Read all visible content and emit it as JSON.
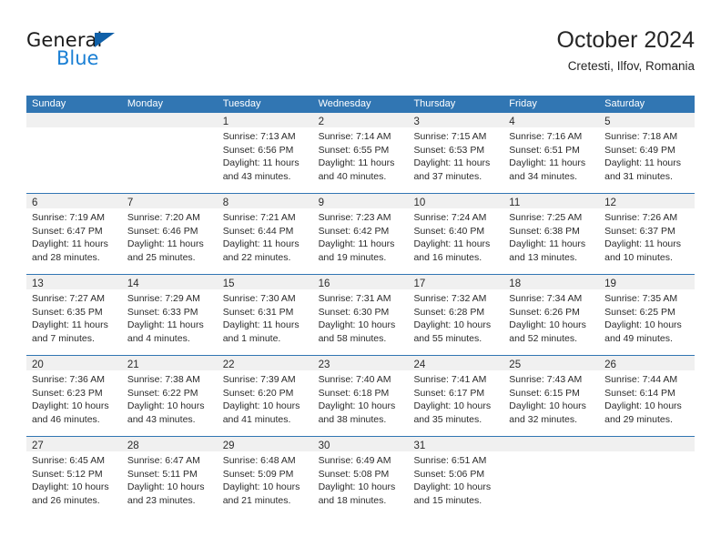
{
  "brand": {
    "name_part1": "General",
    "name_part2": "Blue",
    "triangle_icon": "triangle-icon",
    "color_dark": "#1a1a1a",
    "color_blue": "#1a7fd4"
  },
  "header": {
    "title": "October 2024",
    "subtitle": "Cretesti, Ilfov, Romania"
  },
  "theme": {
    "header_blue": "#3176b3",
    "daynum_band": "#f0f0f0",
    "text": "#2b2b2b"
  },
  "calendar": {
    "weekday_headers": [
      "Sunday",
      "Monday",
      "Tuesday",
      "Wednesday",
      "Thursday",
      "Friday",
      "Saturday"
    ],
    "labels": {
      "sunrise_prefix": "Sunrise:",
      "sunset_prefix": "Sunset:",
      "daylight_prefix": "Daylight:"
    },
    "weeks": [
      [
        {
          "day": "",
          "lines": []
        },
        {
          "day": "",
          "lines": []
        },
        {
          "day": "1",
          "lines": [
            "Sunrise: 7:13 AM",
            "Sunset: 6:56 PM",
            "Daylight: 11 hours",
            "and 43 minutes."
          ]
        },
        {
          "day": "2",
          "lines": [
            "Sunrise: 7:14 AM",
            "Sunset: 6:55 PM",
            "Daylight: 11 hours",
            "and 40 minutes."
          ]
        },
        {
          "day": "3",
          "lines": [
            "Sunrise: 7:15 AM",
            "Sunset: 6:53 PM",
            "Daylight: 11 hours",
            "and 37 minutes."
          ]
        },
        {
          "day": "4",
          "lines": [
            "Sunrise: 7:16 AM",
            "Sunset: 6:51 PM",
            "Daylight: 11 hours",
            "and 34 minutes."
          ]
        },
        {
          "day": "5",
          "lines": [
            "Sunrise: 7:18 AM",
            "Sunset: 6:49 PM",
            "Daylight: 11 hours",
            "and 31 minutes."
          ]
        }
      ],
      [
        {
          "day": "6",
          "lines": [
            "Sunrise: 7:19 AM",
            "Sunset: 6:47 PM",
            "Daylight: 11 hours",
            "and 28 minutes."
          ]
        },
        {
          "day": "7",
          "lines": [
            "Sunrise: 7:20 AM",
            "Sunset: 6:46 PM",
            "Daylight: 11 hours",
            "and 25 minutes."
          ]
        },
        {
          "day": "8",
          "lines": [
            "Sunrise: 7:21 AM",
            "Sunset: 6:44 PM",
            "Daylight: 11 hours",
            "and 22 minutes."
          ]
        },
        {
          "day": "9",
          "lines": [
            "Sunrise: 7:23 AM",
            "Sunset: 6:42 PM",
            "Daylight: 11 hours",
            "and 19 minutes."
          ]
        },
        {
          "day": "10",
          "lines": [
            "Sunrise: 7:24 AM",
            "Sunset: 6:40 PM",
            "Daylight: 11 hours",
            "and 16 minutes."
          ]
        },
        {
          "day": "11",
          "lines": [
            "Sunrise: 7:25 AM",
            "Sunset: 6:38 PM",
            "Daylight: 11 hours",
            "and 13 minutes."
          ]
        },
        {
          "day": "12",
          "lines": [
            "Sunrise: 7:26 AM",
            "Sunset: 6:37 PM",
            "Daylight: 11 hours",
            "and 10 minutes."
          ]
        }
      ],
      [
        {
          "day": "13",
          "lines": [
            "Sunrise: 7:27 AM",
            "Sunset: 6:35 PM",
            "Daylight: 11 hours",
            "and 7 minutes."
          ]
        },
        {
          "day": "14",
          "lines": [
            "Sunrise: 7:29 AM",
            "Sunset: 6:33 PM",
            "Daylight: 11 hours",
            "and 4 minutes."
          ]
        },
        {
          "day": "15",
          "lines": [
            "Sunrise: 7:30 AM",
            "Sunset: 6:31 PM",
            "Daylight: 11 hours",
            "and 1 minute."
          ]
        },
        {
          "day": "16",
          "lines": [
            "Sunrise: 7:31 AM",
            "Sunset: 6:30 PM",
            "Daylight: 10 hours",
            "and 58 minutes."
          ]
        },
        {
          "day": "17",
          "lines": [
            "Sunrise: 7:32 AM",
            "Sunset: 6:28 PM",
            "Daylight: 10 hours",
            "and 55 minutes."
          ]
        },
        {
          "day": "18",
          "lines": [
            "Sunrise: 7:34 AM",
            "Sunset: 6:26 PM",
            "Daylight: 10 hours",
            "and 52 minutes."
          ]
        },
        {
          "day": "19",
          "lines": [
            "Sunrise: 7:35 AM",
            "Sunset: 6:25 PM",
            "Daylight: 10 hours",
            "and 49 minutes."
          ]
        }
      ],
      [
        {
          "day": "20",
          "lines": [
            "Sunrise: 7:36 AM",
            "Sunset: 6:23 PM",
            "Daylight: 10 hours",
            "and 46 minutes."
          ]
        },
        {
          "day": "21",
          "lines": [
            "Sunrise: 7:38 AM",
            "Sunset: 6:22 PM",
            "Daylight: 10 hours",
            "and 43 minutes."
          ]
        },
        {
          "day": "22",
          "lines": [
            "Sunrise: 7:39 AM",
            "Sunset: 6:20 PM",
            "Daylight: 10 hours",
            "and 41 minutes."
          ]
        },
        {
          "day": "23",
          "lines": [
            "Sunrise: 7:40 AM",
            "Sunset: 6:18 PM",
            "Daylight: 10 hours",
            "and 38 minutes."
          ]
        },
        {
          "day": "24",
          "lines": [
            "Sunrise: 7:41 AM",
            "Sunset: 6:17 PM",
            "Daylight: 10 hours",
            "and 35 minutes."
          ]
        },
        {
          "day": "25",
          "lines": [
            "Sunrise: 7:43 AM",
            "Sunset: 6:15 PM",
            "Daylight: 10 hours",
            "and 32 minutes."
          ]
        },
        {
          "day": "26",
          "lines": [
            "Sunrise: 7:44 AM",
            "Sunset: 6:14 PM",
            "Daylight: 10 hours",
            "and 29 minutes."
          ]
        }
      ],
      [
        {
          "day": "27",
          "lines": [
            "Sunrise: 6:45 AM",
            "Sunset: 5:12 PM",
            "Daylight: 10 hours",
            "and 26 minutes."
          ]
        },
        {
          "day": "28",
          "lines": [
            "Sunrise: 6:47 AM",
            "Sunset: 5:11 PM",
            "Daylight: 10 hours",
            "and 23 minutes."
          ]
        },
        {
          "day": "29",
          "lines": [
            "Sunrise: 6:48 AM",
            "Sunset: 5:09 PM",
            "Daylight: 10 hours",
            "and 21 minutes."
          ]
        },
        {
          "day": "30",
          "lines": [
            "Sunrise: 6:49 AM",
            "Sunset: 5:08 PM",
            "Daylight: 10 hours",
            "and 18 minutes."
          ]
        },
        {
          "day": "31",
          "lines": [
            "Sunrise: 6:51 AM",
            "Sunset: 5:06 PM",
            "Daylight: 10 hours",
            "and 15 minutes."
          ]
        },
        {
          "day": "",
          "lines": []
        },
        {
          "day": "",
          "lines": []
        }
      ]
    ]
  }
}
